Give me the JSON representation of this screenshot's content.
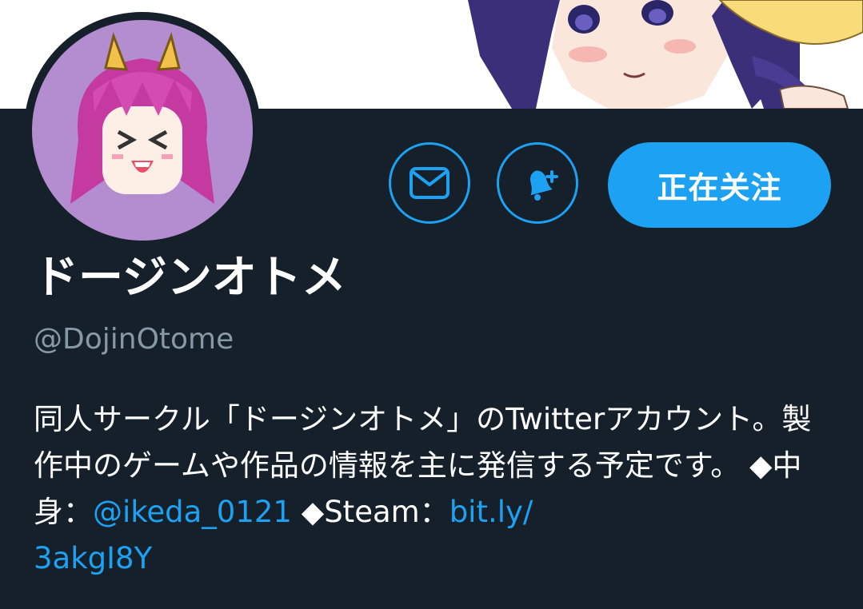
{
  "profile": {
    "display_name": "ドージンオトメ",
    "handle": "@DojinOtome",
    "bio": {
      "text_1": "同人サークル「ドージンオトメ」のTwitterアカウント。製作中のゲームや作品の情報を主に発信する予定です。 ◆中身：",
      "mention": "@ikeda_0121",
      "text_2": " ◆Steam：",
      "link_1": "bit.ly/",
      "link_2": "3akgI8Y"
    }
  },
  "actions": {
    "follow_label": "正在关注",
    "message_icon": "envelope-icon",
    "notify_icon": "bell-plus-icon"
  },
  "colors": {
    "background": "#15202b",
    "accent": "#1da1f2",
    "secondary_text": "#8899a6",
    "avatar_bg": "#b48cd0"
  }
}
